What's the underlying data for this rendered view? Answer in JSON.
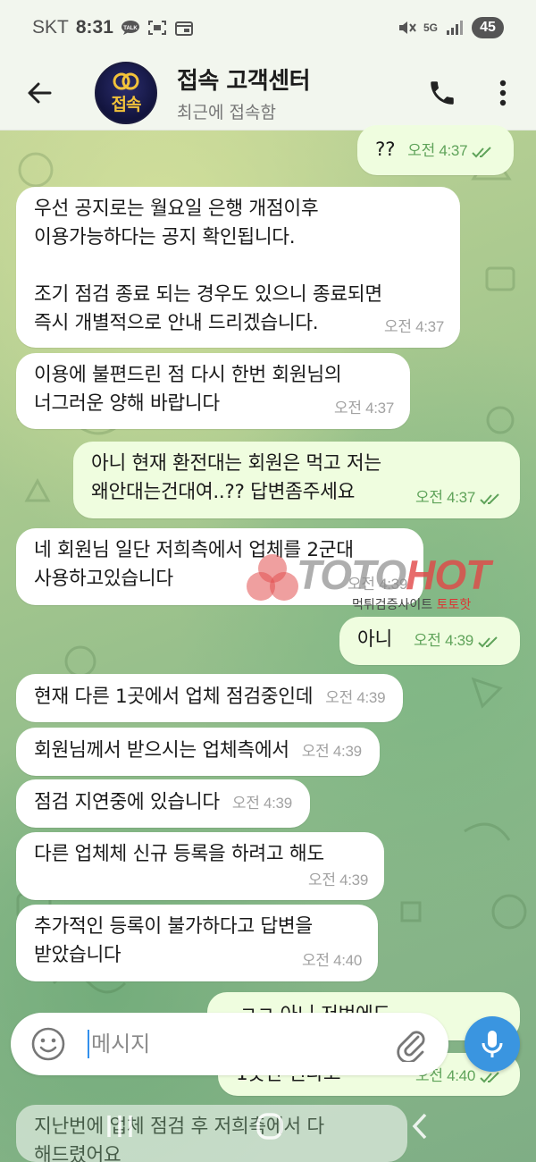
{
  "status_bar": {
    "carrier": "SKT",
    "time": "8:31",
    "network": "5G",
    "battery": "45",
    "icons": [
      "talk-icon",
      "screenshot-icon",
      "calendar-icon",
      "mute-icon",
      "signal-icon"
    ]
  },
  "header": {
    "avatar_text": "접속",
    "title": "접속 고객센터",
    "subtitle": "최근에 접속함",
    "icons": [
      "back-arrow-icon",
      "phone-icon",
      "more-vert-icon"
    ]
  },
  "messages": [
    {
      "dir": "out",
      "text": "??",
      "time": "오전 4:37",
      "read": true
    },
    {
      "dir": "in",
      "text": "우선 공지로는 월요일 은행 개점이후\n이용가능하다는 공지 확인됩니다.\n\n조기 점검 종료 되는 경우도 있으니 종료되면\n즉시 개별적으로 안내 드리겠습니다.",
      "time": "오전 4:37"
    },
    {
      "dir": "in",
      "text": "이용에 불편드린 점 다시 한번 회원님의\n너그러운 양해 바랍니다",
      "time": "오전 4:37"
    },
    {
      "dir": "out",
      "text": "아니 현재 환전대는 회원은 먹고 저는\n왜안대는건대여..?? 답변좀주세요",
      "time": "오전 4:37",
      "read": true
    },
    {
      "dir": "in",
      "text": "네 회원님 일단 저희측에서 업체를 2군대\n사용하고있습니다",
      "time": "오전 4:39"
    },
    {
      "dir": "out",
      "text": "아니",
      "time": "오전 4:39",
      "read": true
    },
    {
      "dir": "in",
      "text": "현재 다른 1곳에서 업체 점검중인데",
      "time": "오전 4:39"
    },
    {
      "dir": "in",
      "text": "회원님께서 받으시는 업체측에서",
      "time": "오전 4:39"
    },
    {
      "dir": "in",
      "text": "점검 지연중에 있습니다",
      "time": "오전 4:39"
    },
    {
      "dir": "in",
      "text": "다른 업체체 신규 등록을 하려고 해도",
      "time": "오전 4:39"
    },
    {
      "dir": "in",
      "text": "추가적인 등록이 불가하다고 답변을\n받았습니다",
      "time": "오전 4:40"
    },
    {
      "dir": "out",
      "text": "ㅋㅋ 아니 저번에도",
      "time": "",
      "read": false
    },
    {
      "dir": "out",
      "text": "1곳만 된다고",
      "time": "오전 4:40",
      "read": true
    },
    {
      "dir": "in",
      "text": "지난번에 업체 점검 후 저희측에서 다\n해드렸어요",
      "time": ""
    }
  ],
  "watermark": {
    "logo_toto": "TOTO",
    "logo_hot": "HOT",
    "sub_text": "먹튀검증사이트",
    "sub_brand": "토토핫"
  },
  "composer": {
    "placeholder": "메시지",
    "icons": [
      "emoji-icon",
      "attach-icon",
      "mic-icon"
    ]
  },
  "nav_bar": {
    "icons": [
      "recent-apps-icon",
      "home-icon",
      "back-icon"
    ]
  },
  "colors": {
    "incoming_bubble": "#ffffff",
    "outgoing_bubble": "#effddf",
    "outgoing_time": "#5fa35a",
    "accent": "#3a95e0"
  }
}
